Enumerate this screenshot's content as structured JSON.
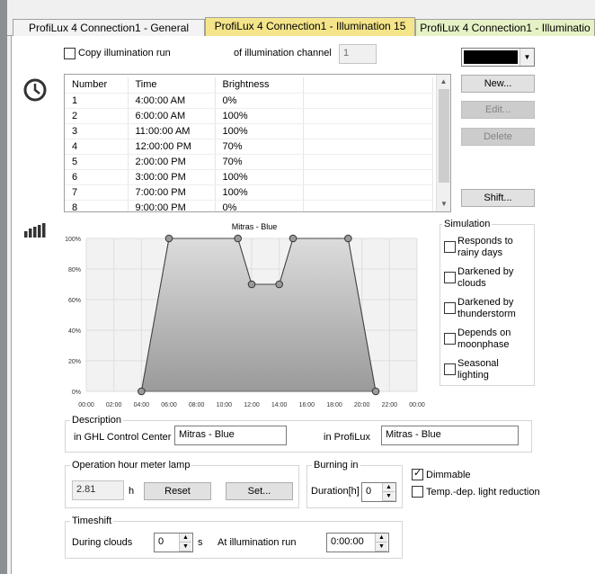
{
  "tabs": [
    {
      "label": "ProfiLux 4 Connection1 - General"
    },
    {
      "label": "ProfiLux 4 Connection1 - Illumination 15"
    },
    {
      "label": "ProfiLux 4 Connection1 - Illuminatio"
    }
  ],
  "copy_run": {
    "label": "Copy illumination run",
    "of_channel_label": "of illumination channel",
    "channel_value": "1"
  },
  "color_swatch": "#000000",
  "schedule": {
    "headers": [
      "Number",
      "Time",
      "Brightness"
    ],
    "rows": [
      [
        "1",
        "4:00:00 AM",
        "0%"
      ],
      [
        "2",
        "6:00:00 AM",
        "100%"
      ],
      [
        "3",
        "11:00:00 AM",
        "100%"
      ],
      [
        "4",
        "12:00:00 PM",
        "70%"
      ],
      [
        "5",
        "2:00:00 PM",
        "70%"
      ],
      [
        "6",
        "3:00:00 PM",
        "100%"
      ],
      [
        "7",
        "7:00:00 PM",
        "100%"
      ],
      [
        "8",
        "9:00:00 PM",
        "0%"
      ]
    ]
  },
  "buttons": {
    "new": "New...",
    "edit": "Edit...",
    "delete": "Delete",
    "shift": "Shift..."
  },
  "chart_data": {
    "type": "area",
    "title": "Mitras - Blue",
    "x_ticks": [
      "00:00",
      "02:00",
      "04:00",
      "06:00",
      "08:00",
      "10:00",
      "12:00",
      "14:00",
      "16:00",
      "18:00",
      "20:00",
      "22:00",
      "00:00"
    ],
    "y_ticks": [
      "0%",
      "20%",
      "40%",
      "60%",
      "80%",
      "100%"
    ],
    "xlim": [
      0,
      24
    ],
    "ylim": [
      0,
      100
    ],
    "points": [
      {
        "x": 4,
        "y": 0
      },
      {
        "x": 6,
        "y": 100
      },
      {
        "x": 11,
        "y": 100
      },
      {
        "x": 12,
        "y": 70
      },
      {
        "x": 14,
        "y": 70
      },
      {
        "x": 15,
        "y": 100
      },
      {
        "x": 19,
        "y": 100
      },
      {
        "x": 21,
        "y": 0
      }
    ],
    "grid": true
  },
  "simulation": {
    "title": "Simulation",
    "options": [
      {
        "line1": "Responds to",
        "line2": "rainy days"
      },
      {
        "line1": "Darkened by",
        "line2": "clouds"
      },
      {
        "line1": "Darkened by",
        "line2": "thunderstorm"
      },
      {
        "line1": "Depends on",
        "line2": "moonphase"
      },
      {
        "line1": "Seasonal",
        "line2": "lighting"
      }
    ]
  },
  "description": {
    "title": "Description",
    "ghl_label": "in GHL Control Center",
    "ghl_value": "Mitras - Blue",
    "profilux_label": "in ProfiLux",
    "profilux_value": "Mitras - Blue"
  },
  "meter": {
    "title": "Operation hour meter lamp",
    "value": "2.81",
    "unit": "h",
    "reset": "Reset",
    "set": "Set..."
  },
  "burning": {
    "title": "Burning in",
    "label": "Duration[h]",
    "value": "0"
  },
  "dimmable": {
    "label": "Dimmable",
    "checked": true
  },
  "temp_reduction": {
    "label": "Temp.-dep. light reduction",
    "checked": false
  },
  "timeshift": {
    "title": "Timeshift",
    "clouds_label": "During clouds",
    "clouds_value": "0",
    "clouds_unit": "s",
    "run_label": "At illumination run",
    "run_value": "0:00:00"
  }
}
